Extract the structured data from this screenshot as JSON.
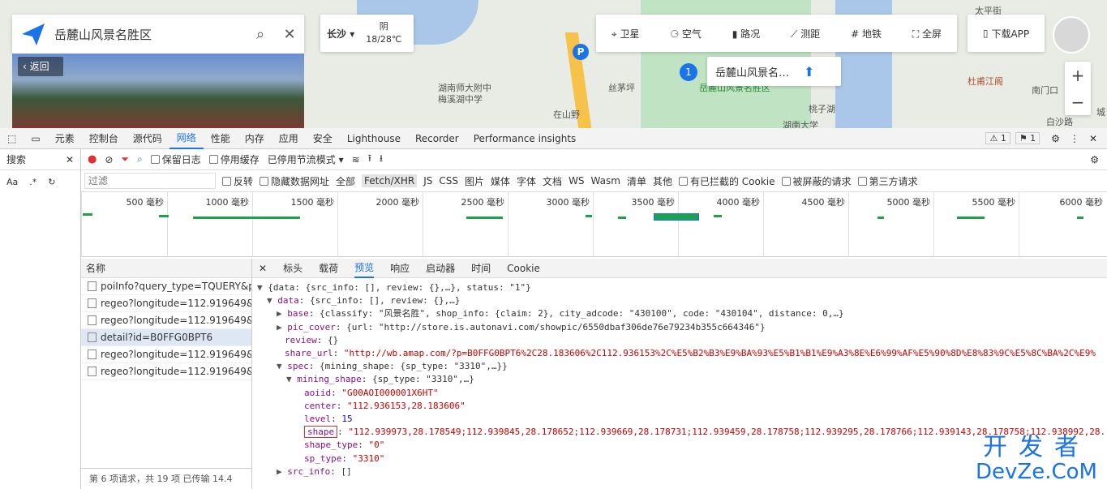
{
  "map": {
    "search_text": "岳麓山风景名胜区",
    "back_label": "返回",
    "city": "长沙",
    "weather": "阴",
    "temp": "18/28℃",
    "tools": [
      "卫星",
      "空气",
      "路况",
      "测距",
      "地铁",
      "全屏"
    ],
    "download": "下载APP",
    "poi_tip": "岳麓山风景名…",
    "labels": [
      "湖南师大附中",
      "梅溪湖中学",
      "丝茅坪",
      "在山野",
      "岳麓山风景名胜区",
      "桃子湖",
      "湖南大学",
      "太平街",
      "杜甫江阁",
      "南门口",
      "白沙路",
      "城"
    ],
    "zoom_in": "+",
    "zoom_out": "−",
    "marker_num": "1"
  },
  "devtools": {
    "tabs": [
      "元素",
      "控制台",
      "源代码",
      "网络",
      "性能",
      "内存",
      "应用",
      "安全",
      "Lighthouse",
      "Recorder",
      "Performance insights"
    ],
    "active_tab": "网络",
    "warn_count": "1",
    "issue_count": "1",
    "search_label": "搜索",
    "toolbar": {
      "preserve_log": "保留日志",
      "disable_cache": "停用缓存",
      "throttle": "已停用节流模式"
    },
    "filter": {
      "placeholder": "过滤",
      "invert": "反转",
      "hide_data": "隐藏数据网址",
      "all": "全部",
      "types": [
        "Fetch/XHR",
        "JS",
        "CSS",
        "图片",
        "媒体",
        "字体",
        "文档",
        "WS",
        "Wasm",
        "清单",
        "其他"
      ],
      "blocked_cookies": "有已拦截的 Cookie",
      "blocked_req": "被屏蔽的请求",
      "third_party": "第三方请求"
    },
    "timeline": [
      "500 毫秒",
      "1000 毫秒",
      "1500 毫秒",
      "2000 毫秒",
      "2500 毫秒",
      "3000 毫秒",
      "3500 毫秒",
      "4000 毫秒",
      "4500 毫秒",
      "5000 毫秒",
      "5500 毫秒",
      "6000 毫秒"
    ],
    "names_header": "名称",
    "requests": [
      "poiInfo?query_type=TQUERY&p...",
      "regeo?longitude=112.919649&l...",
      "regeo?longitude=112.919649&l...",
      "detail?id=B0FFG0BPT6",
      "regeo?longitude=112.919649&l...",
      "regeo?longitude=112.919649&l..."
    ],
    "selected_index": 3,
    "status": "第 6 项请求，共 19 项   已传输 14.4",
    "detail_tabs": [
      "标头",
      "载荷",
      "预览",
      "响应",
      "启动器",
      "时间",
      "Cookie"
    ],
    "active_detail": "预览",
    "preview": [
      {
        "indent": 0,
        "arrow": "▼",
        "html": "{data: {src_info: [], review: {},…}, status: \"1\"}"
      },
      {
        "indent": 1,
        "arrow": "▼",
        "key": "data",
        "rest": "{src_info: [], review: {},…}"
      },
      {
        "indent": 2,
        "arrow": "▶",
        "key": "base",
        "rest": "{classify: \"风景名胜\", shop_info: {claim: 2}, city_adcode: \"430100\", code: \"430104\", distance: 0,…}"
      },
      {
        "indent": 2,
        "arrow": "▶",
        "key": "pic_cover",
        "rest": "{url: \"http://store.is.autonavi.com/showpic/6550dbaf306de76e79234b355c664346\"}"
      },
      {
        "indent": 2,
        "arrow": "",
        "key": "review",
        "rest": "{}"
      },
      {
        "indent": 2,
        "arrow": "",
        "key": "share_url",
        "str": "\"http://wb.amap.com/?p=B0FFG0BPT6%2C28.183606%2C112.936153%2C%E5%B2%B3%E9%BA%93%E5%B1%B1%E9%A3%8E%E6%99%AF%E5%90%8D%E8%83%9C%E5%8C%BA%2C%E9%"
      },
      {
        "indent": 2,
        "arrow": "▼",
        "key": "spec",
        "rest": "{mining_shape: {sp_type: \"3310\",…}}"
      },
      {
        "indent": 3,
        "arrow": "▼",
        "key": "mining_shape",
        "rest": "{sp_type: \"3310\",…}"
      },
      {
        "indent": 4,
        "arrow": "",
        "key": "aoiid",
        "str": "\"G00AOI000001X6HT\""
      },
      {
        "indent": 4,
        "arrow": "",
        "key": "center",
        "str": "\"112.936153,28.183606\""
      },
      {
        "indent": 4,
        "arrow": "",
        "key": "level",
        "num": "15"
      },
      {
        "indent": 4,
        "arrow": "",
        "key": "shape",
        "str": "\"112.939973,28.178549;112.939845,28.178652;112.939669,28.178731;112.939459,28.178758;112.939295,28.178766;112.939143,28.178758;112.938992,28.",
        "hl": true
      },
      {
        "indent": 4,
        "arrow": "",
        "key": "shape_type",
        "str": "\"0\""
      },
      {
        "indent": 4,
        "arrow": "",
        "key": "sp_type",
        "str": "\"3310\""
      },
      {
        "indent": 2,
        "arrow": "▶",
        "key": "src_info",
        "rest": "[]"
      }
    ],
    "watermark": {
      "line1": "开发者",
      "line2": "DevZe.CoM"
    }
  }
}
